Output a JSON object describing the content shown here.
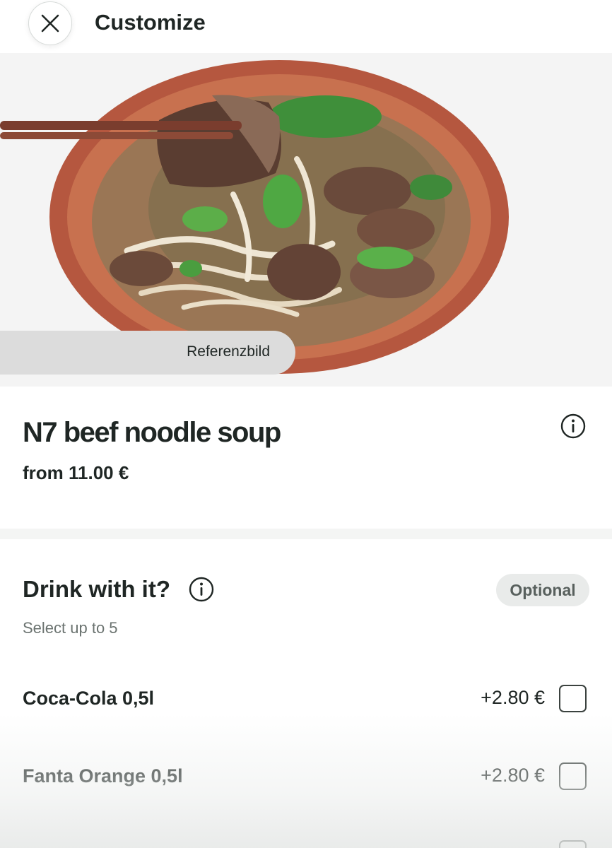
{
  "header": {
    "title": "Customize",
    "close_icon": "close-icon"
  },
  "hero": {
    "image_subject": "beef noodle soup in bowl with chopsticks",
    "reference_label": "Referenzbild"
  },
  "product": {
    "name": "N7 beef noodle soup",
    "price": "from 11.00 €",
    "info_icon": "info-icon"
  },
  "option_group": {
    "title": "Drink with it?",
    "info_icon": "info-icon",
    "badge": "Optional",
    "subtitle": "Select up to 5",
    "options": [
      {
        "name": "Coca-Cola 0,5l",
        "price": "+2.80 €",
        "checked": false
      },
      {
        "name": "Fanta Orange 0,5l",
        "price": "+2.80 €",
        "checked": false
      },
      {
        "name": "",
        "price": "",
        "checked": false
      }
    ]
  },
  "colors": {
    "text": "#1f2624",
    "muted": "#6b7370",
    "badge_bg": "#e9ebea",
    "hero_bg": "#f4f4f4",
    "bowl": "#b5573f"
  }
}
